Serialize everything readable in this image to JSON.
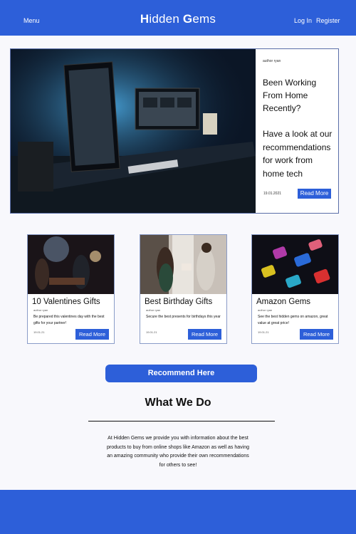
{
  "header": {
    "menu_label": "Menu",
    "logo_initial_1": "H",
    "logo_rest_1": "idden ",
    "logo_initial_2": "G",
    "logo_rest_2": "ems",
    "login_label": "Log In",
    "register_label": "Register"
  },
  "colors": {
    "brand_blue": "#2d5fd9",
    "page_background": "#f8f8fc"
  },
  "hero": {
    "author": "author ryan",
    "title": "Been Working From Home Recently?",
    "subtitle": "Have a look at our recommendations for work from home tech",
    "date": "19.01.2021",
    "button_label": "Read More"
  },
  "cards": [
    {
      "title": "10 Valentines Gifts",
      "author": "author ryan",
      "description": "Be prepared this valentines day with the best gifts for your partner!",
      "date": "19.01.21",
      "button_label": "Read More"
    },
    {
      "title": "Best Birthday Gifts",
      "author": "author ryan",
      "description": "Secure the best presents for birthdays this year",
      "date": "19.01.21",
      "button_label": "Read More"
    },
    {
      "title": "Amazon Gems",
      "author": "author ryan",
      "description": "See the best hidden gems on amazon, great value at great price!",
      "date": "19.01.21",
      "button_label": "Read More"
    }
  ],
  "recommend_button_label": "Recommend Here",
  "what_we_do": {
    "title": "What We Do",
    "body": "At Hidden Gems we provide you with information about the best products to buy from online shops like Amazon as well as having an amazing community who provide their own recommendations for others to see!"
  }
}
